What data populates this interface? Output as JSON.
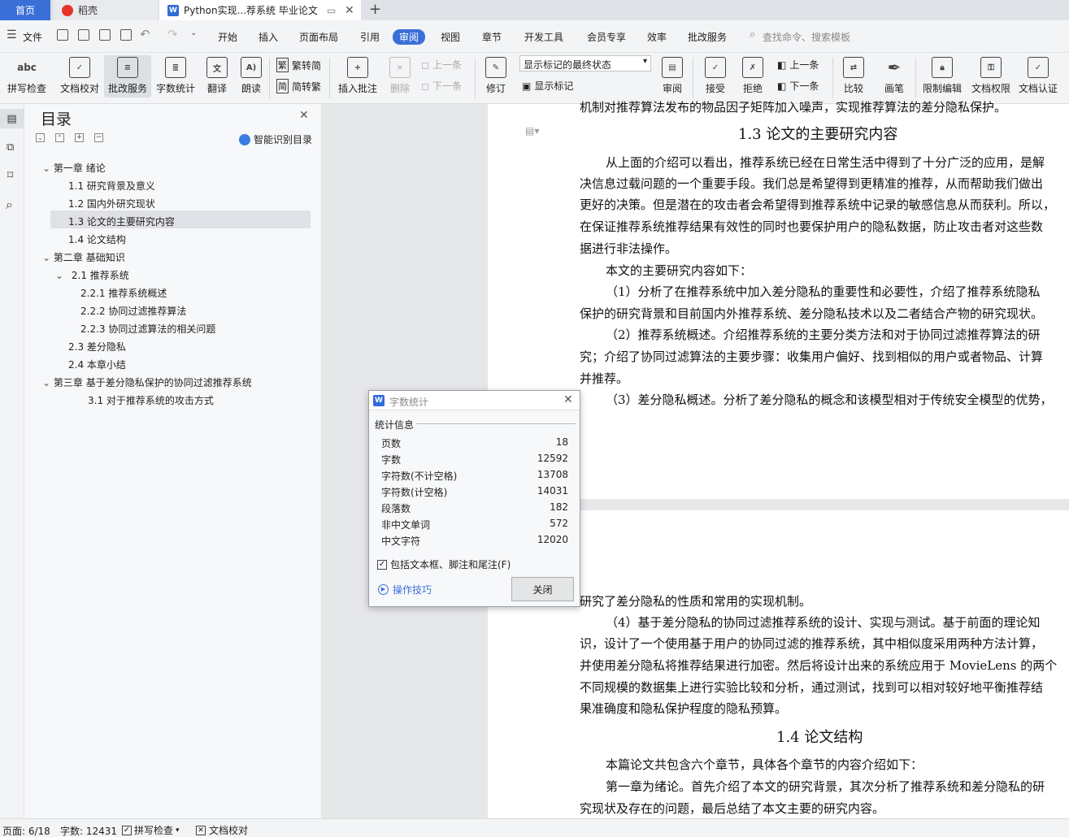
{
  "tabs": {
    "home": "首页",
    "daoke": "稻壳",
    "doc": "Python实现...荐系统 毕业论文"
  },
  "menubar": {
    "file": "文件",
    "items": [
      "开始",
      "插入",
      "页面布局",
      "引用",
      "审阅",
      "视图",
      "章节",
      "开发工具",
      "会员专享",
      "效率",
      "批改服务"
    ],
    "search": "查找命令、搜索模板"
  },
  "ribbon": {
    "spell": "拼写检查",
    "doc_check": "文档校对",
    "correct_service": "批改服务",
    "word_count": "字数统计",
    "translate": "翻译",
    "read_aloud": "朗读",
    "trad": "繁转简",
    "simp": "简转繁",
    "insert_comment": "插入批注",
    "delete": "删除",
    "prev_comment": "上一条",
    "next_comment": "下一条",
    "revise": "修订",
    "markup_state": "显示标记的最终状态",
    "show_markup": "显示标记",
    "review": "审阅",
    "accept": "接受",
    "reject": "拒绝",
    "prev": "上一条",
    "next": "下一条",
    "compare": "比较",
    "pen": "画笔",
    "restrict": "限制编辑",
    "perm": "文档权限",
    "cert": "文档认证"
  },
  "toc": {
    "title": "目录",
    "smart": "智能识别目录",
    "items": [
      "第一章 绪论",
      "1.1 研究背景及意义",
      "1.2 国内外研究现状",
      "1.3 论文的主要研究内容",
      "1.4 论文结构",
      "第二章 基础知识",
      "2.1 推荐系统",
      "2.2.1 推荐系统概述",
      "2.2.2 协同过滤推荐算法",
      "2.2.3 协同过滤算法的相关问题",
      "2.3 差分隐私",
      "2.4 本章小结",
      "第三章 基于差分隐私保护的协同过滤推荐系统",
      "3.1 对于推荐系统的攻击方式"
    ]
  },
  "doc": {
    "top_line": "机制对推荐算法发布的物品因子矩阵加入噪声，实现推荐算法的差分隐私保护。",
    "heading13": "1.3 论文的主要研究内容",
    "p1": [
      "从上面的介绍可以看出，推荐系统已经在日常生活中得到了十分广泛的应用，是解",
      "决信息过载问题的一个重要手段。我们总是希望得到更精准的推荐，从而帮助我们做出",
      "更好的决策。但是潜在的攻击者会希望得到推荐系统中记录的敏感信息从而获利。所以，",
      "在保证推荐系统推荐结果有效性的同时也要保护用户的隐私数据，防止攻击者对这些数",
      "据进行非法操作。"
    ],
    "p2": "本文的主要研究内容如下：",
    "p3": [
      "（1）分析了在推荐系统中加入差分隐私的重要性和必要性，介绍了推荐系统隐私",
      "保护的研究背景和目前国内外推荐系统、差分隐私技术以及二者结合产物的研究现状。"
    ],
    "p4": [
      "（2）推荐系统概述。介绍推荐系统的主要分类方法和对于协同过滤推荐算法的研",
      "究；介绍了协同过滤算法的主要步骤：收集用户偏好、找到相似的用户或者物品、计算",
      "并推荐。"
    ],
    "p5": "（3）差分隐私概述。分析了差分隐私的概念和该模型相对于传统安全模型的优势，",
    "p6": "研究了差分隐私的性质和常用的实现机制。",
    "p7": [
      "（4）基于差分隐私的协同过滤推荐系统的设计、实现与测试。基于前面的理论知",
      "识，设计了一个使用基于用户的协同过滤的推荐系统，其中相似度采用两种方法计算，",
      "并使用差分隐私将推荐结果进行加密。然后将设计出来的系统应用于 MovieLens 的两个",
      "不同规模的数据集上进行实验比较和分析，通过测试，找到可以相对较好地平衡推荐结",
      "果准确度和隐私保护程度的隐私预算。"
    ],
    "heading14": "1.4 论文结构",
    "p8": "本篇论文共包含六个章节，具体各个章节的内容介绍如下：",
    "p9": [
      "第一章为绪论。首先介绍了本文的研究背景，其次分析了推荐系统和差分隐私的研",
      "究现状及存在的问题，最后总结了本文主要的研究内容。"
    ]
  },
  "dialog": {
    "title": "字数统计",
    "section": "统计信息",
    "rows": [
      {
        "label": "页数",
        "value": "18"
      },
      {
        "label": "字数",
        "value": "12592"
      },
      {
        "label": "字符数(不计空格)",
        "value": "13708"
      },
      {
        "label": "字符数(计空格)",
        "value": "14031"
      },
      {
        "label": "段落数",
        "value": "182"
      },
      {
        "label": "非中文单词",
        "value": "572"
      },
      {
        "label": "中文字符",
        "value": "12020"
      }
    ],
    "checkbox": "包括文本框、脚注和尾注(F)",
    "tips": "操作技巧",
    "close": "关闭"
  },
  "status": {
    "page": "页面: 6/18",
    "words": "字数: 12431",
    "spell": "拼写检查",
    "proof": "文档校对"
  }
}
